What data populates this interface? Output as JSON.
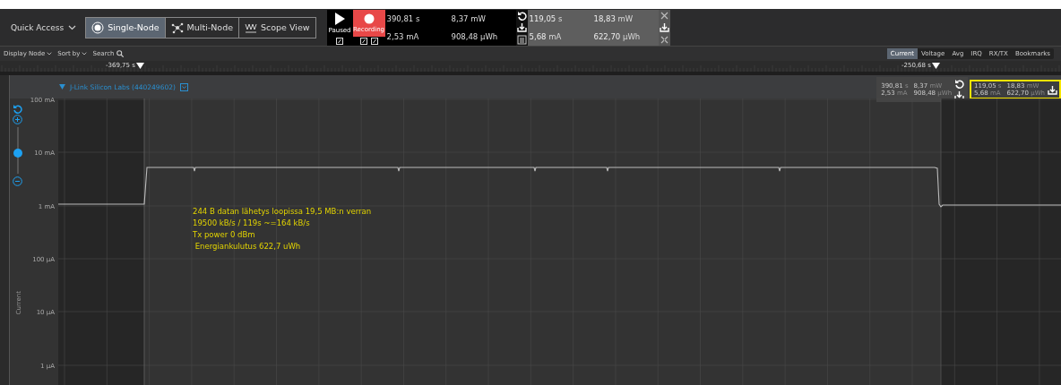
{
  "toolbar": {
    "quick_access": "Quick Access",
    "views": [
      {
        "label": "Single-Node",
        "selected": true
      },
      {
        "label": "Multi-Node",
        "selected": false
      },
      {
        "label": "Scope View",
        "selected": false
      }
    ],
    "play": {
      "label": "Paused"
    },
    "record": {
      "label": "Recording",
      "on": true
    },
    "live_readings": [
      {
        "value": "390,81",
        "unit": "s"
      },
      {
        "value": "8,37",
        "unit": "mW"
      },
      {
        "value": "2,53",
        "unit": "mA"
      },
      {
        "value": "908,48",
        "unit": "μWh"
      }
    ],
    "selection_readings": [
      {
        "value": "119,05",
        "unit": "s"
      },
      {
        "value": "18,83",
        "unit": "mW"
      },
      {
        "value": "5,68",
        "unit": "mA"
      },
      {
        "value": "622,70",
        "unit": "μWh"
      }
    ]
  },
  "subbar": {
    "menus": [
      "Display Node",
      "Sort by"
    ],
    "search": "Search",
    "tabs": [
      {
        "label": "Current",
        "selected": true
      },
      {
        "label": "Voltage",
        "selected": false
      },
      {
        "label": "Avg",
        "selected": false
      },
      {
        "label": "IRQ",
        "selected": false
      },
      {
        "label": "RX/TX",
        "selected": false
      },
      {
        "label": "Bookmarks",
        "selected": false
      }
    ]
  },
  "ruler": {
    "markers": [
      "-369,75 s",
      "-250,68 s"
    ]
  },
  "panel": {
    "device": "J-Link Silicon Labs (440249602)",
    "zoom": {
      "level": 0.45
    },
    "y_axis_label": "Current",
    "y_ticks": [
      "100 mA",
      "10 mA",
      "1 mA",
      "100 μA",
      "10 μA",
      "1 μA"
    ],
    "note_lines": [
      "244 B datan lähetys loopissa 19,5 MB:n verran",
      "19500 kB/s / 119s ~=164 kB/s",
      "Tx power 0 dBm",
      " Energiankulutus 622,7 uWh"
    ],
    "live_readings": [
      {
        "value": "390,81",
        "unit": "s"
      },
      {
        "value": "8,37",
        "unit": "mW"
      },
      {
        "value": "2,53",
        "unit": "mA"
      },
      {
        "value": "908,48",
        "unit": "μWh"
      }
    ],
    "selection_readings": [
      {
        "value": "119,05",
        "unit": "s"
      },
      {
        "value": "18,83",
        "unit": "mW"
      },
      {
        "value": "5,68",
        "unit": "mA"
      },
      {
        "value": "622,70",
        "unit": "μWh"
      }
    ],
    "selection_highlighted": true
  }
}
